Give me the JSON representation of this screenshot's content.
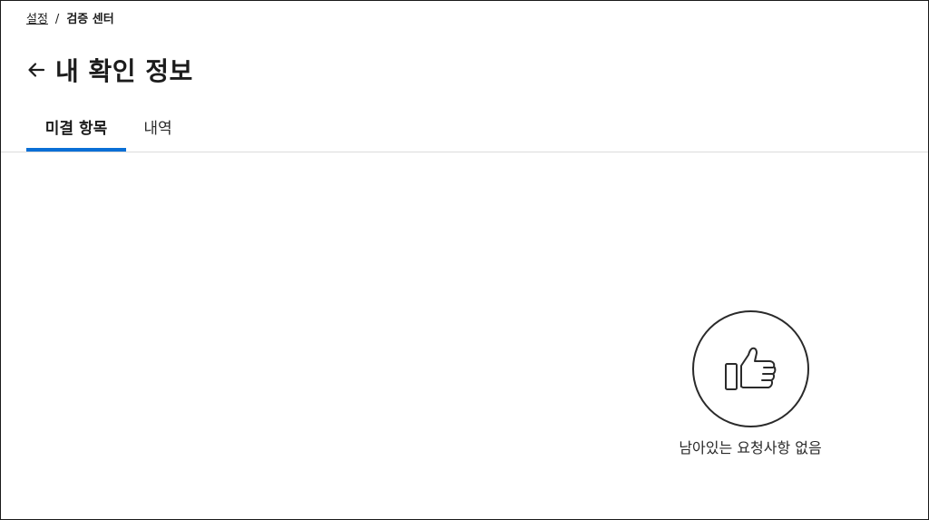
{
  "breadcrumb": {
    "parent": "설정",
    "separator": "/",
    "current": "검증 센터"
  },
  "header": {
    "back_icon": "arrow-left-icon",
    "title": "내 확인 정보"
  },
  "tabs": [
    {
      "label": "미결 항목",
      "active": true
    },
    {
      "label": "내역",
      "active": false
    }
  ],
  "empty_state": {
    "icon": "thumbs-up-icon",
    "message": "남아있는 요청사항 없음"
  },
  "colors": {
    "accent": "#0a6fd6",
    "text": "#1c1c1c",
    "divider": "#dcdcdc"
  }
}
